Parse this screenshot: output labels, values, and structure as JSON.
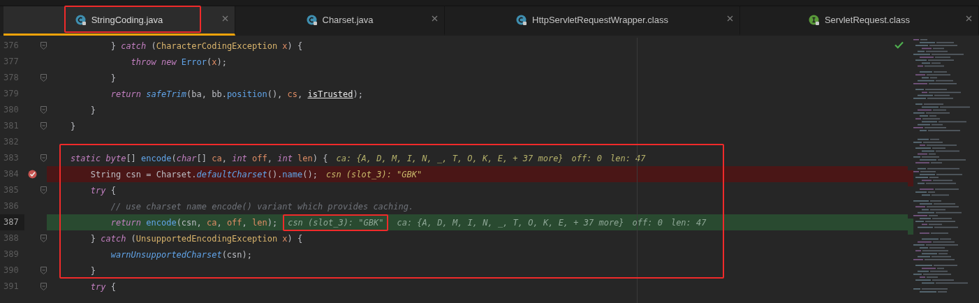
{
  "tabs": [
    {
      "label": "StringCoding.java",
      "kind": "class",
      "selected": true,
      "outlined": true
    },
    {
      "label": "Charset.java",
      "kind": "class",
      "selected": false,
      "outlined": false
    },
    {
      "label": "HttpServletRequestWrapper.class",
      "kind": "class",
      "selected": false,
      "outlined": false
    },
    {
      "label": "ServletRequest.class",
      "kind": "interface",
      "selected": false,
      "outlined": false
    }
  ],
  "editor": {
    "lines": [
      {
        "kind": "line",
        "number": "376",
        "current": false,
        "fold": true,
        "breakpoint": false,
        "tokens": [
          {
            "text": "            } ",
            "kind": "plain"
          },
          {
            "text": "catch",
            "kind": "kw"
          },
          {
            "text": " (",
            "kind": "plain"
          },
          {
            "text": "CharacterCodingException",
            "kind": "cls"
          },
          {
            "text": " x",
            "kind": "param"
          },
          {
            "text": ") {",
            "kind": "plain"
          }
        ]
      },
      {
        "kind": "line",
        "number": "377",
        "current": false,
        "fold": false,
        "breakpoint": false,
        "tokens": [
          {
            "text": "                throw",
            "kind": "kw"
          },
          {
            "text": " new",
            "kind": "kw"
          },
          {
            "text": " Error",
            "kind": "fn"
          },
          {
            "text": "(",
            "kind": "plain"
          },
          {
            "text": "x",
            "kind": "param"
          },
          {
            "text": ");",
            "kind": "plain"
          }
        ]
      },
      {
        "kind": "line",
        "number": "378",
        "current": false,
        "fold": true,
        "breakpoint": false,
        "tokens": [
          {
            "text": "            }",
            "kind": "plain"
          }
        ]
      },
      {
        "kind": "line",
        "number": "379",
        "current": false,
        "fold": false,
        "breakpoint": false,
        "tokens": [
          {
            "text": "            return",
            "kind": "kw"
          },
          {
            "text": " safeTrim",
            "kind": "fni"
          },
          {
            "text": "(ba, bb.",
            "kind": "plain"
          },
          {
            "text": "position",
            "kind": "fn"
          },
          {
            "text": "(), ",
            "kind": "plain"
          },
          {
            "text": "cs",
            "kind": "param"
          },
          {
            "text": ", ",
            "kind": "plain"
          },
          {
            "text": "isTrusted",
            "kind": "field"
          },
          {
            "text": ");",
            "kind": "plain"
          }
        ]
      },
      {
        "kind": "line",
        "number": "380",
        "current": false,
        "fold": true,
        "breakpoint": false,
        "tokens": [
          {
            "text": "        }",
            "kind": "plain"
          }
        ]
      },
      {
        "kind": "line",
        "number": "381",
        "current": false,
        "fold": true,
        "breakpoint": false,
        "tokens": [
          {
            "text": "    }",
            "kind": "plain"
          }
        ]
      },
      {
        "kind": "line",
        "number": "382",
        "current": false,
        "fold": false,
        "breakpoint": false
      },
      {
        "kind": "outlined",
        "children": [
          {
            "kind": "line",
            "number": "383",
            "current": false,
            "fold": true,
            "breakpoint": false,
            "tokens": [
              {
                "text": "    static",
                "kind": "kw"
              },
              {
                "text": " byte",
                "kind": "kw"
              },
              {
                "text": "[] ",
                "kind": "plain"
              },
              {
                "text": "encode",
                "kind": "fn"
              },
              {
                "text": "(",
                "kind": "plain"
              },
              {
                "text": "char",
                "kind": "kw"
              },
              {
                "text": "[] ",
                "kind": "plain"
              },
              {
                "text": "ca",
                "kind": "param"
              },
              {
                "text": ", ",
                "kind": "plain"
              },
              {
                "text": "int",
                "kind": "kw"
              },
              {
                "text": " off",
                "kind": "param"
              },
              {
                "text": ", ",
                "kind": "plain"
              },
              {
                "text": "int",
                "kind": "kw"
              },
              {
                "text": " len",
                "kind": "param"
              },
              {
                "text": ") {",
                "kind": "plain"
              }
            ],
            "hints": [
              {
                "text": "ca: {A, D, M, I, N, _, T, O, K, E, + 37 more}",
                "outlined": false
              },
              {
                "text": "off: 0",
                "outlined": false
              },
              {
                "text": "len: 47",
                "outlined": false
              }
            ]
          },
          {
            "kind": "line",
            "number": "384",
            "current": false,
            "fold": false,
            "breakpoint": true,
            "tokens": [
              {
                "text": "        String csn = Charset.",
                "kind": "plain"
              },
              {
                "text": "defaultCharset",
                "kind": "fni"
              },
              {
                "text": "().",
                "kind": "plain"
              },
              {
                "text": "name",
                "kind": "fn"
              },
              {
                "text": "();",
                "kind": "plain"
              }
            ],
            "hints": [
              {
                "text": "csn (slot_3): \"GBK\"",
                "outlined": false
              }
            ]
          },
          {
            "kind": "line",
            "number": "385",
            "current": false,
            "fold": true,
            "breakpoint": false,
            "tokens": [
              {
                "text": "        try",
                "kind": "kw"
              },
              {
                "text": " {",
                "kind": "plain"
              }
            ]
          },
          {
            "kind": "line",
            "number": "386",
            "current": false,
            "fold": false,
            "breakpoint": false,
            "tokens": [
              {
                "text": "            // use charset name encode() variant which provides caching.",
                "kind": "comment"
              }
            ]
          },
          {
            "kind": "line",
            "number": "387",
            "current": true,
            "fold": false,
            "breakpoint": false,
            "tokens": [
              {
                "text": "            return",
                "kind": "kw"
              },
              {
                "text": " encode",
                "kind": "fn"
              },
              {
                "text": "(csn, ",
                "kind": "plain"
              },
              {
                "text": "ca",
                "kind": "param"
              },
              {
                "text": ", ",
                "kind": "plain"
              },
              {
                "text": "off",
                "kind": "param"
              },
              {
                "text": ", ",
                "kind": "plain"
              },
              {
                "text": "len",
                "kind": "param"
              },
              {
                "text": ");",
                "kind": "plain"
              }
            ],
            "hints": [
              {
                "text": "csn (slot_3): \"GBK\"",
                "outlined": true
              },
              {
                "text": "ca: {A, D, M, I, N, _, T, O, K, E, + 37 more}",
                "outlined": false
              },
              {
                "text": "off: 0",
                "outlined": false
              },
              {
                "text": "len: 47",
                "outlined": false
              }
            ]
          },
          {
            "kind": "line",
            "number": "388",
            "current": false,
            "fold": true,
            "breakpoint": false,
            "tokens": [
              {
                "text": "        } ",
                "kind": "plain"
              },
              {
                "text": "catch",
                "kind": "kw"
              },
              {
                "text": " (",
                "kind": "plain"
              },
              {
                "text": "UnsupportedEncodingException",
                "kind": "cls"
              },
              {
                "text": " x",
                "kind": "param"
              },
              {
                "text": ") {",
                "kind": "plain"
              }
            ]
          },
          {
            "kind": "line",
            "number": "389",
            "current": false,
            "fold": false,
            "breakpoint": false,
            "tokens": [
              {
                "text": "            warnUnsupportedCharset",
                "kind": "fni"
              },
              {
                "text": "(csn);",
                "kind": "plain"
              }
            ]
          },
          {
            "kind": "line",
            "number": "390",
            "current": false,
            "fold": true,
            "breakpoint": false,
            "tokens": [
              {
                "text": "        }",
                "kind": "plain"
              }
            ]
          }
        ]
      },
      {
        "kind": "line",
        "number": "391",
        "current": false,
        "fold": true,
        "breakpoint": false,
        "tokens": [
          {
            "text": "        try",
            "kind": "kw"
          },
          {
            "text": " {",
            "kind": "plain"
          }
        ]
      }
    ]
  }
}
